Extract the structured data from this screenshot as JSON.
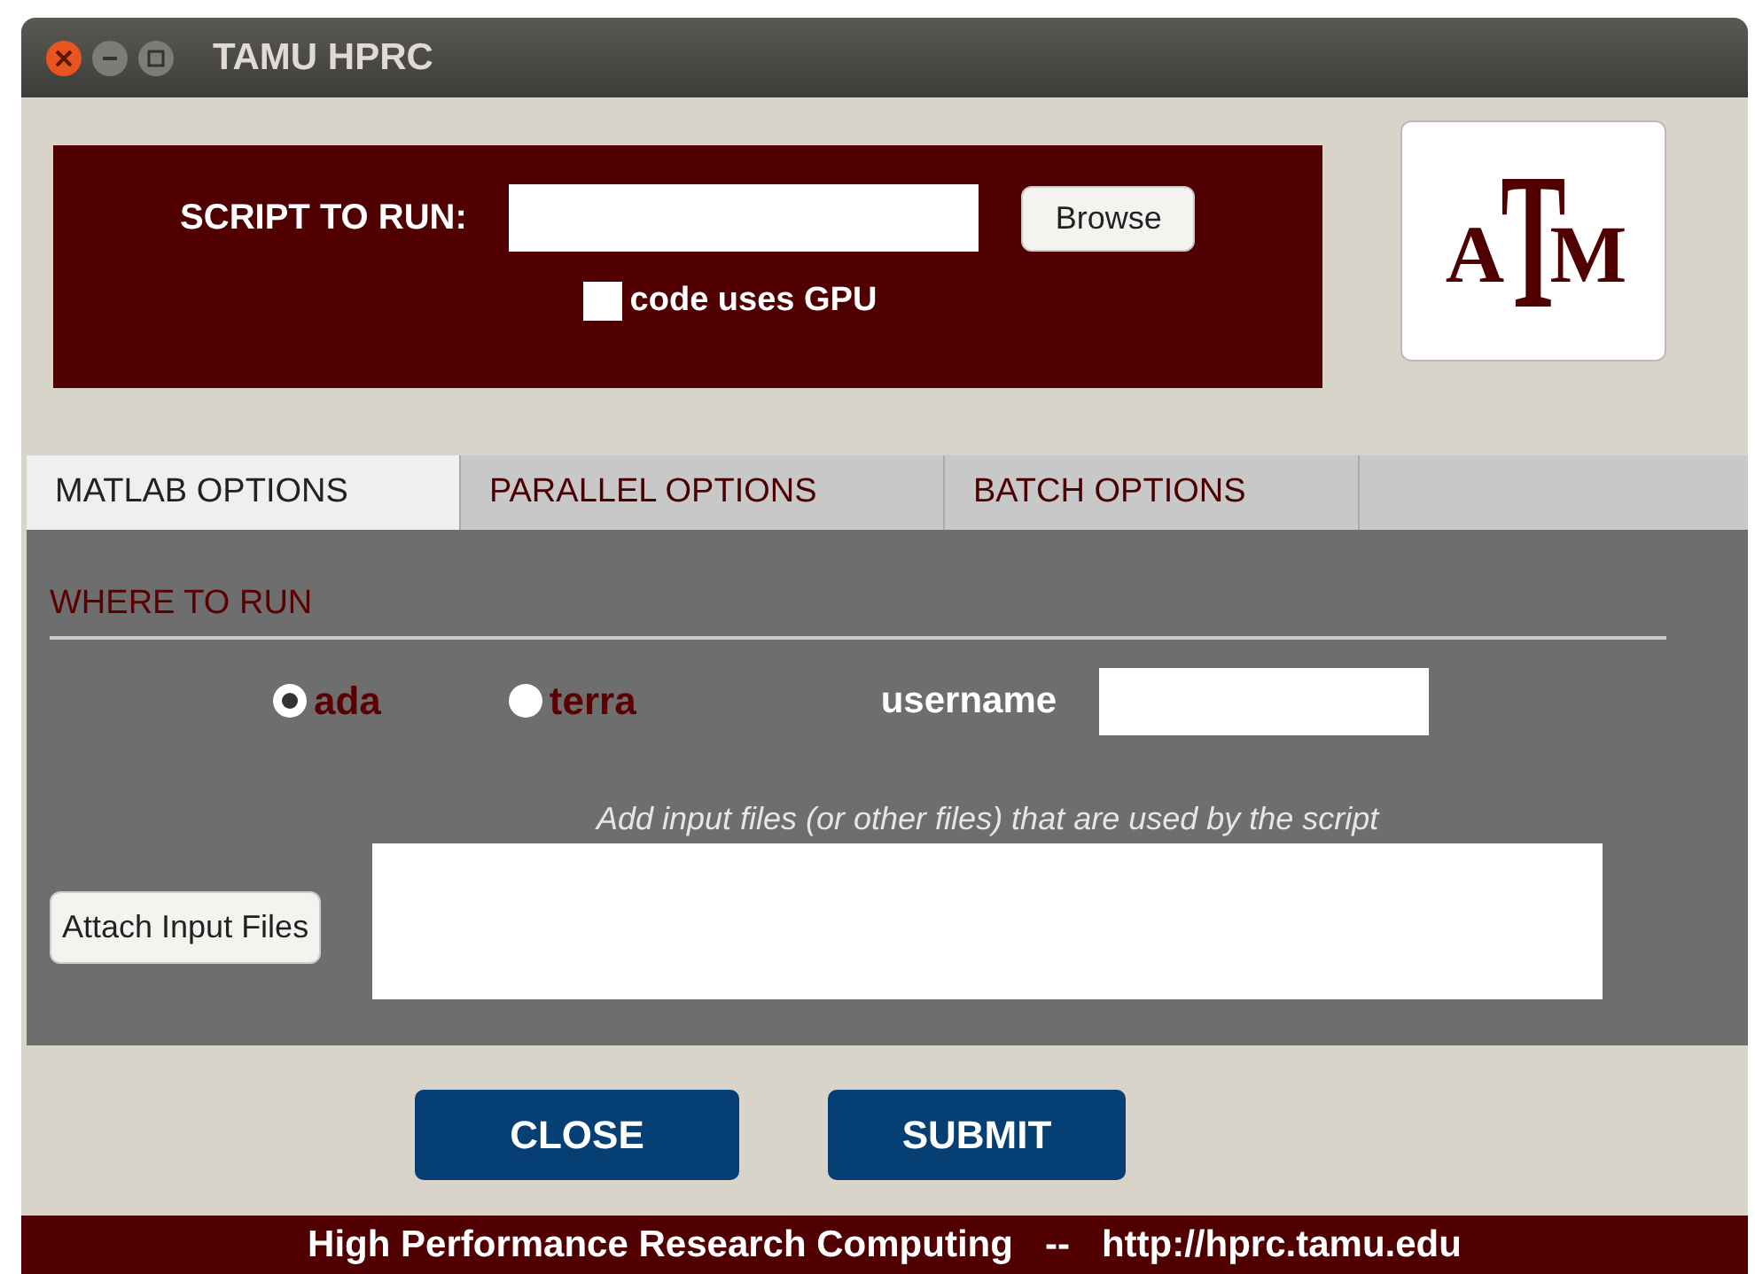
{
  "window": {
    "title": "TAMU HPRC"
  },
  "script": {
    "label": "SCRIPT TO RUN:",
    "browse": "Browse",
    "gpu": {
      "label": "code uses GPU",
      "checked": false
    }
  },
  "logo": {
    "letters": [
      "A",
      "T",
      "M"
    ]
  },
  "tabs": [
    {
      "label": "MATLAB OPTIONS",
      "selected": true
    },
    {
      "label": "PARALLEL OPTIONS",
      "selected": false
    },
    {
      "label": "BATCH OPTIONS",
      "selected": false
    }
  ],
  "where_to_run": {
    "heading": "WHERE TO RUN",
    "options": [
      {
        "label": "ada",
        "selected": true
      },
      {
        "label": "terra",
        "selected": false
      }
    ],
    "username_label": "username"
  },
  "input_files": {
    "hint": "Add input files (or other files) that are used by the script",
    "button": "Attach Input Files"
  },
  "buttons": [
    "CLOSE",
    "SUBMIT"
  ],
  "footer": {
    "text": "High Performance Research Computing",
    "separator": "--",
    "url": "http://hprc.tamu.edu"
  }
}
